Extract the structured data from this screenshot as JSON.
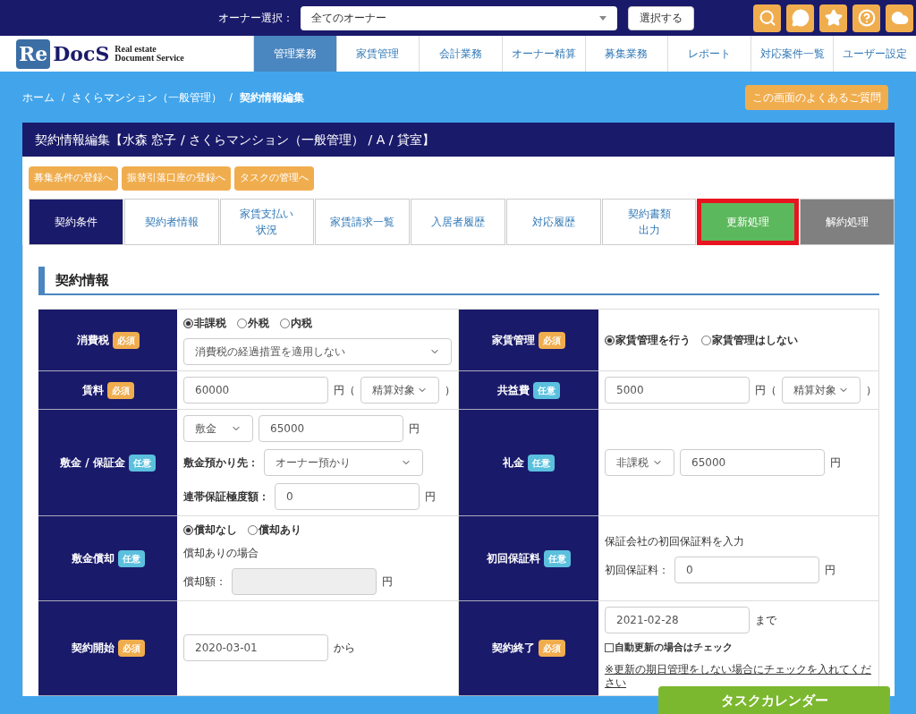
{
  "topbar": {
    "owner_label": "オーナー選択：",
    "owner_select": "全てのオーナー",
    "select_button": "選択する"
  },
  "logo": {
    "mark_re": "Re",
    "mark_docs": "DocS",
    "tagline_1": "Real estate",
    "tagline_2": "Document Service"
  },
  "nav": [
    {
      "label": "管理業務",
      "selected": true
    },
    {
      "label": "家賃管理",
      "selected": false
    },
    {
      "label": "会計業務",
      "selected": false
    },
    {
      "label": "オーナー精算",
      "selected": false
    },
    {
      "label": "募集業務",
      "selected": false
    },
    {
      "label": "レポート",
      "selected": false
    },
    {
      "label": "対応案件一覧",
      "selected": false
    },
    {
      "label": "ユーザー設定",
      "selected": false
    }
  ],
  "breadcrumb": [
    {
      "label": "ホーム",
      "current": false
    },
    {
      "separator": "/",
      "label": "さくらマンション（一般管理）",
      "current": false
    },
    {
      "separator": "/",
      "label": "契約情報編集",
      "current": true
    }
  ],
  "faq_button": "この画面のよくあるご質問",
  "panel_title": "契約情報編集【水森 窓子 / さくらマンション（一般管理） / A / 貸室】",
  "action_buttons": [
    "募集条件の登録へ",
    "振替引落口座の登録へ",
    "タスクの管理へ"
  ],
  "tabs": [
    {
      "label": "契約条件",
      "kind": "normal",
      "selected": true,
      "outlined": false
    },
    {
      "label": "契約者情報",
      "kind": "normal",
      "selected": false,
      "outlined": false
    },
    {
      "label_lines": [
        "家賃支払い",
        "状況"
      ],
      "kind": "normal",
      "selected": false,
      "outlined": false
    },
    {
      "label": "家賃請求一覧",
      "kind": "normal",
      "selected": false,
      "outlined": false
    },
    {
      "label": "入居者履歴",
      "kind": "normal",
      "selected": false,
      "outlined": false
    },
    {
      "label": "対応履歴",
      "kind": "normal",
      "selected": false,
      "outlined": false
    },
    {
      "label_lines": [
        "契約書類",
        "出力"
      ],
      "kind": "normal",
      "selected": false,
      "outlined": false
    },
    {
      "label": "更新処理",
      "kind": "renew",
      "selected": false,
      "outlined": true
    },
    {
      "label": "解約処理",
      "kind": "cancel",
      "selected": false,
      "outlined": false
    }
  ],
  "section_title": "契約情報",
  "rows": [
    {
      "cells": [
        {
          "label": "消費税",
          "badge": {
            "kind": "required",
            "text": "必須"
          },
          "lines": [
            [
              {
                "kind": "radios",
                "options": [
                  {
                    "label": "非課税",
                    "selected": true
                  },
                  {
                    "label": "外税",
                    "selected": false
                  },
                  {
                    "label": "内税",
                    "selected": false
                  }
                ]
              }
            ],
            [
              {
                "kind": "select",
                "value": "消費税の経過措置を適用しない"
              }
            ]
          ]
        },
        {
          "label": "家賃管理",
          "badge": {
            "kind": "required",
            "text": "必須"
          },
          "lines": [
            [
              {
                "kind": "radios",
                "options": [
                  {
                    "label": "家賃管理を行う",
                    "selected": true
                  },
                  {
                    "label": "家賃管理はしない",
                    "selected": false
                  }
                ]
              }
            ]
          ]
        }
      ]
    },
    {
      "cells": [
        {
          "label": "賃料",
          "badge": {
            "kind": "required",
            "text": "必須"
          },
          "lines": [
            [
              {
                "kind": "input",
                "value": "60000"
              },
              {
                "kind": "text",
                "text": "円（"
              },
              {
                "kind": "select",
                "value": "精算対象"
              },
              {
                "kind": "text",
                "text": "）"
              }
            ]
          ]
        },
        {
          "label": "共益費",
          "badge": {
            "kind": "optional",
            "text": "任意"
          },
          "lines": [
            [
              {
                "kind": "input",
                "value": "5000"
              },
              {
                "kind": "text",
                "text": "円（"
              },
              {
                "kind": "select",
                "value": "精算対象"
              },
              {
                "kind": "text",
                "text": "）"
              }
            ]
          ]
        }
      ]
    },
    {
      "cells": [
        {
          "label": "敷金 / 保証金",
          "badge": {
            "kind": "optional",
            "text": "任意"
          },
          "lines": [
            [
              {
                "kind": "select",
                "value": "敷金"
              },
              {
                "kind": "input",
                "value": "65000"
              },
              {
                "kind": "text",
                "text": "円"
              }
            ],
            [
              {
                "kind": "label",
                "text": "敷金預かり先："
              },
              {
                "kind": "select",
                "value": "オーナー預かり"
              }
            ],
            [
              {
                "kind": "label",
                "text": "連帯保証極度額："
              },
              {
                "kind": "input",
                "value": "0"
              },
              {
                "kind": "text",
                "text": "円"
              }
            ]
          ]
        },
        {
          "label": "礼金",
          "badge": {
            "kind": "optional",
            "text": "任意"
          },
          "lines": [
            [
              {
                "kind": "select",
                "value": "非課税"
              },
              {
                "kind": "input",
                "value": "65000"
              },
              {
                "kind": "text",
                "text": "円"
              }
            ]
          ]
        }
      ]
    },
    {
      "cells": [
        {
          "label": "敷金償却",
          "badge": {
            "kind": "optional",
            "text": "任意"
          },
          "lines": [
            [
              {
                "kind": "radios",
                "options": [
                  {
                    "label": "償却なし",
                    "selected": true
                  },
                  {
                    "label": "償却あり",
                    "selected": false
                  }
                ]
              }
            ],
            [
              {
                "kind": "text",
                "text": "償却ありの場合"
              }
            ],
            [
              {
                "kind": "text",
                "text": "償却額："
              },
              {
                "kind": "input",
                "disabled": true
              },
              {
                "kind": "text",
                "text": "円"
              }
            ]
          ]
        },
        {
          "label": "初回保証料",
          "badge": {
            "kind": "optional",
            "text": "任意"
          },
          "lines": [
            [
              {
                "kind": "text",
                "text": "保証会社の初回保証料を入力"
              }
            ],
            [
              {
                "kind": "text",
                "text": "初回保証料："
              },
              {
                "kind": "input",
                "value": "0"
              },
              {
                "kind": "text",
                "text": "円"
              }
            ]
          ]
        }
      ]
    },
    {
      "cells": [
        {
          "label": "契約開始",
          "badge": {
            "kind": "required",
            "text": "必須"
          },
          "lines": [
            [
              {
                "kind": "input",
                "value": "2020-03-01"
              },
              {
                "kind": "text",
                "text": "から"
              }
            ]
          ]
        },
        {
          "label": "契約終了",
          "badge": {
            "kind": "required",
            "text": "必須"
          },
          "lines": [
            [
              {
                "kind": "input",
                "value": "2021-02-28"
              },
              {
                "kind": "text",
                "text": "まで"
              }
            ],
            [
              {
                "kind": "checkbox",
                "label": "自動更新の場合はチェック",
                "checked": false
              }
            ],
            [
              {
                "kind": "note",
                "text": "※更新の期日管理をしない場合にチェックを入れてください"
              }
            ]
          ]
        }
      ]
    }
  ],
  "task_calendar_button": "タスクカレンダー"
}
